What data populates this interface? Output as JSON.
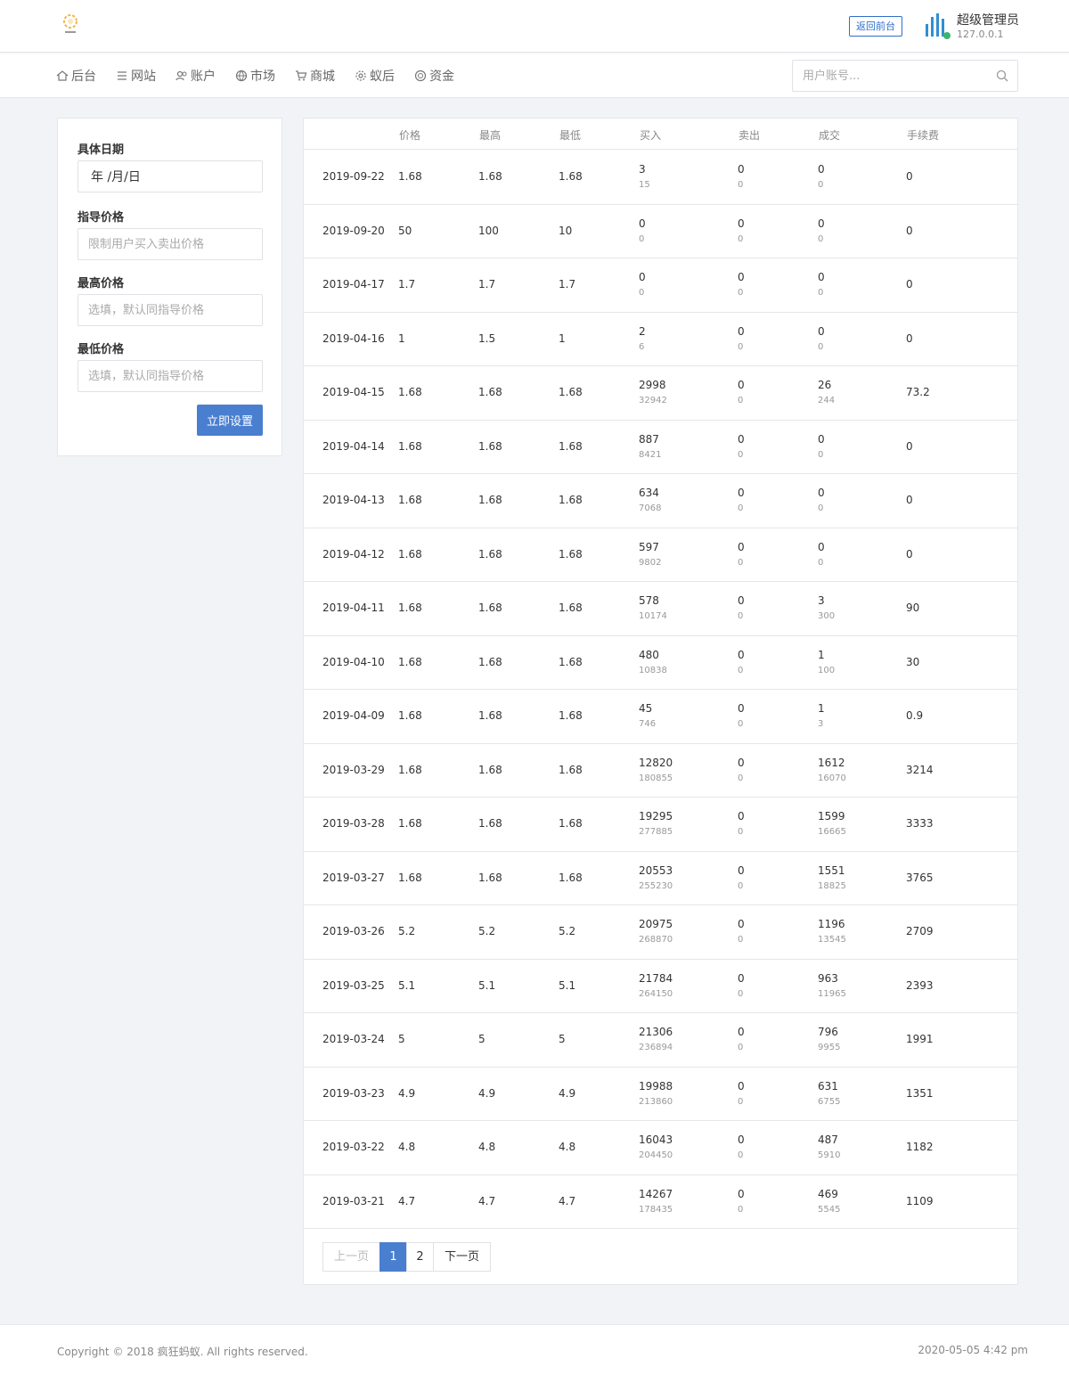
{
  "header": {
    "front_button": "返回前台",
    "admin_name": "超级管理员",
    "admin_ip": "127.0.0.1"
  },
  "nav": {
    "items": [
      {
        "label": "后台",
        "icon": "home-icon"
      },
      {
        "label": "网站",
        "icon": "list-icon"
      },
      {
        "label": "账户",
        "icon": "users-icon"
      },
      {
        "label": "市场",
        "icon": "globe-icon"
      },
      {
        "label": "商城",
        "icon": "cart-icon"
      },
      {
        "label": "蚁后",
        "icon": "gear-icon"
      },
      {
        "label": "资金",
        "icon": "coin-icon"
      }
    ],
    "search_placeholder": "用户账号..."
  },
  "form": {
    "date_label": "具体日期",
    "date_value": "年 /月/日",
    "guide_label": "指导价格",
    "guide_placeholder": "限制用户买入卖出价格",
    "max_label": "最高价格",
    "max_placeholder": "选填，默认同指导价格",
    "min_label": "最低价格",
    "min_placeholder": "选填，默认同指导价格",
    "submit_label": "立即设置"
  },
  "table": {
    "headers": [
      "价格",
      "最高",
      "最低",
      "买入",
      "卖出",
      "成交",
      "手续费"
    ],
    "rows": [
      {
        "date": "2019-09-22",
        "price": "1.68",
        "high": "1.68",
        "low": "1.68",
        "buy": "3",
        "buy_sub": "15",
        "sell": "0",
        "sell_sub": "0",
        "deal": "0",
        "deal_sub": "0",
        "fee": "0"
      },
      {
        "date": "2019-09-20",
        "price": "50",
        "high": "100",
        "low": "10",
        "buy": "0",
        "buy_sub": "0",
        "sell": "0",
        "sell_sub": "0",
        "deal": "0",
        "deal_sub": "0",
        "fee": "0"
      },
      {
        "date": "2019-04-17",
        "price": "1.7",
        "high": "1.7",
        "low": "1.7",
        "buy": "0",
        "buy_sub": "0",
        "sell": "0",
        "sell_sub": "0",
        "deal": "0",
        "deal_sub": "0",
        "fee": "0"
      },
      {
        "date": "2019-04-16",
        "price": "1",
        "high": "1.5",
        "low": "1",
        "buy": "2",
        "buy_sub": "6",
        "sell": "0",
        "sell_sub": "0",
        "deal": "0",
        "deal_sub": "0",
        "fee": "0"
      },
      {
        "date": "2019-04-15",
        "price": "1.68",
        "high": "1.68",
        "low": "1.68",
        "buy": "2998",
        "buy_sub": "32942",
        "sell": "0",
        "sell_sub": "0",
        "deal": "26",
        "deal_sub": "244",
        "fee": "73.2"
      },
      {
        "date": "2019-04-14",
        "price": "1.68",
        "high": "1.68",
        "low": "1.68",
        "buy": "887",
        "buy_sub": "8421",
        "sell": "0",
        "sell_sub": "0",
        "deal": "0",
        "deal_sub": "0",
        "fee": "0"
      },
      {
        "date": "2019-04-13",
        "price": "1.68",
        "high": "1.68",
        "low": "1.68",
        "buy": "634",
        "buy_sub": "7068",
        "sell": "0",
        "sell_sub": "0",
        "deal": "0",
        "deal_sub": "0",
        "fee": "0"
      },
      {
        "date": "2019-04-12",
        "price": "1.68",
        "high": "1.68",
        "low": "1.68",
        "buy": "597",
        "buy_sub": "9802",
        "sell": "0",
        "sell_sub": "0",
        "deal": "0",
        "deal_sub": "0",
        "fee": "0"
      },
      {
        "date": "2019-04-11",
        "price": "1.68",
        "high": "1.68",
        "low": "1.68",
        "buy": "578",
        "buy_sub": "10174",
        "sell": "0",
        "sell_sub": "0",
        "deal": "3",
        "deal_sub": "300",
        "fee": "90"
      },
      {
        "date": "2019-04-10",
        "price": "1.68",
        "high": "1.68",
        "low": "1.68",
        "buy": "480",
        "buy_sub": "10838",
        "sell": "0",
        "sell_sub": "0",
        "deal": "1",
        "deal_sub": "100",
        "fee": "30"
      },
      {
        "date": "2019-04-09",
        "price": "1.68",
        "high": "1.68",
        "low": "1.68",
        "buy": "45",
        "buy_sub": "746",
        "sell": "0",
        "sell_sub": "0",
        "deal": "1",
        "deal_sub": "3",
        "fee": "0.9"
      },
      {
        "date": "2019-03-29",
        "price": "1.68",
        "high": "1.68",
        "low": "1.68",
        "buy": "12820",
        "buy_sub": "180855",
        "sell": "0",
        "sell_sub": "0",
        "deal": "1612",
        "deal_sub": "16070",
        "fee": "3214"
      },
      {
        "date": "2019-03-28",
        "price": "1.68",
        "high": "1.68",
        "low": "1.68",
        "buy": "19295",
        "buy_sub": "277885",
        "sell": "0",
        "sell_sub": "0",
        "deal": "1599",
        "deal_sub": "16665",
        "fee": "3333"
      },
      {
        "date": "2019-03-27",
        "price": "1.68",
        "high": "1.68",
        "low": "1.68",
        "buy": "20553",
        "buy_sub": "255230",
        "sell": "0",
        "sell_sub": "0",
        "deal": "1551",
        "deal_sub": "18825",
        "fee": "3765"
      },
      {
        "date": "2019-03-26",
        "price": "5.2",
        "high": "5.2",
        "low": "5.2",
        "buy": "20975",
        "buy_sub": "268870",
        "sell": "0",
        "sell_sub": "0",
        "deal": "1196",
        "deal_sub": "13545",
        "fee": "2709"
      },
      {
        "date": "2019-03-25",
        "price": "5.1",
        "high": "5.1",
        "low": "5.1",
        "buy": "21784",
        "buy_sub": "264150",
        "sell": "0",
        "sell_sub": "0",
        "deal": "963",
        "deal_sub": "11965",
        "fee": "2393"
      },
      {
        "date": "2019-03-24",
        "price": "5",
        "high": "5",
        "low": "5",
        "buy": "21306",
        "buy_sub": "236894",
        "sell": "0",
        "sell_sub": "0",
        "deal": "796",
        "deal_sub": "9955",
        "fee": "1991"
      },
      {
        "date": "2019-03-23",
        "price": "4.9",
        "high": "4.9",
        "low": "4.9",
        "buy": "19988",
        "buy_sub": "213860",
        "sell": "0",
        "sell_sub": "0",
        "deal": "631",
        "deal_sub": "6755",
        "fee": "1351"
      },
      {
        "date": "2019-03-22",
        "price": "4.8",
        "high": "4.8",
        "low": "4.8",
        "buy": "16043",
        "buy_sub": "204450",
        "sell": "0",
        "sell_sub": "0",
        "deal": "487",
        "deal_sub": "5910",
        "fee": "1182"
      },
      {
        "date": "2019-03-21",
        "price": "4.7",
        "high": "4.7",
        "low": "4.7",
        "buy": "14267",
        "buy_sub": "178435",
        "sell": "0",
        "sell_sub": "0",
        "deal": "469",
        "deal_sub": "5545",
        "fee": "1109"
      }
    ]
  },
  "pager": {
    "prev": "上一页",
    "pages": [
      "1",
      "2"
    ],
    "active": "1",
    "next": "下一页"
  },
  "footer": {
    "copyright": "Copyright © 2018 疯狂蚂蚁. All rights reserved.",
    "datetime": "2020-05-05 4:42 pm"
  },
  "colors": {
    "accent": "#4a7fd0",
    "border": "#e4e6ea",
    "background": "#f1f3f7"
  }
}
